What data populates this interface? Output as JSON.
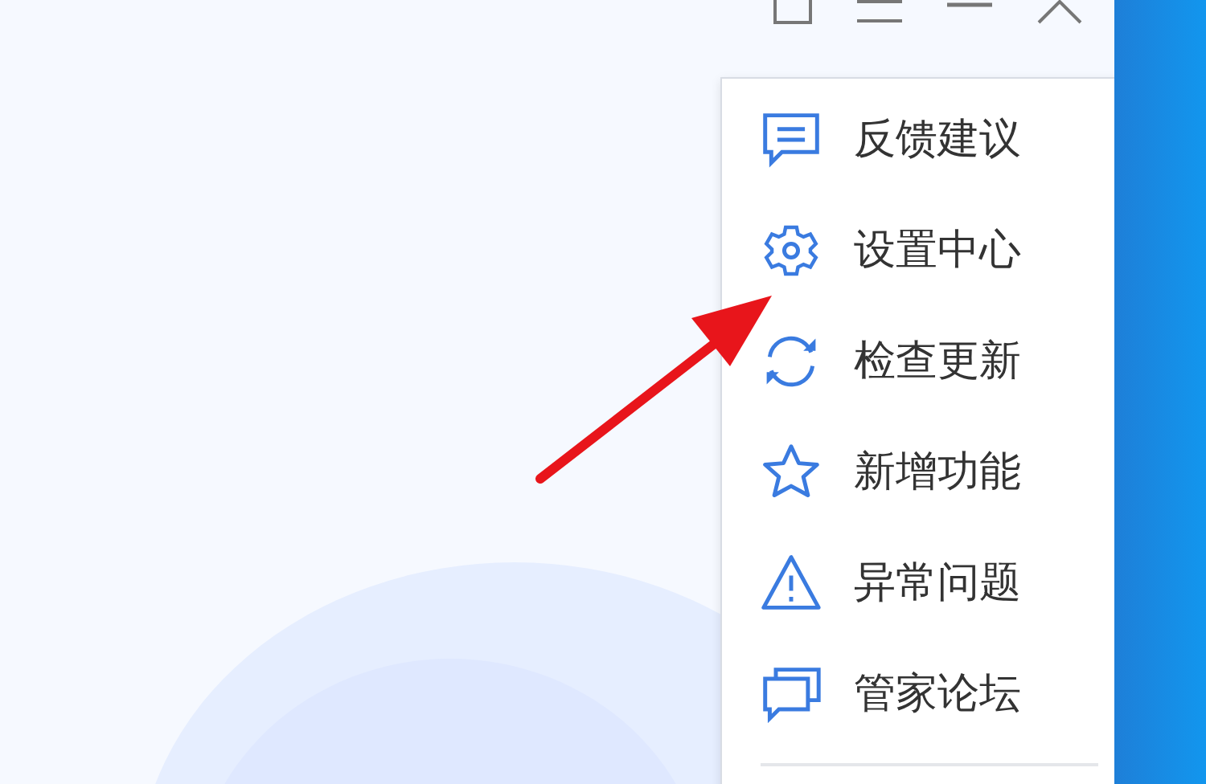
{
  "menu": {
    "items": [
      {
        "label": "反馈建议"
      },
      {
        "label": "设置中心"
      },
      {
        "label": "检查更新"
      },
      {
        "label": "新增功能"
      },
      {
        "label": "异常问题"
      },
      {
        "label": "管家论坛"
      }
    ]
  }
}
